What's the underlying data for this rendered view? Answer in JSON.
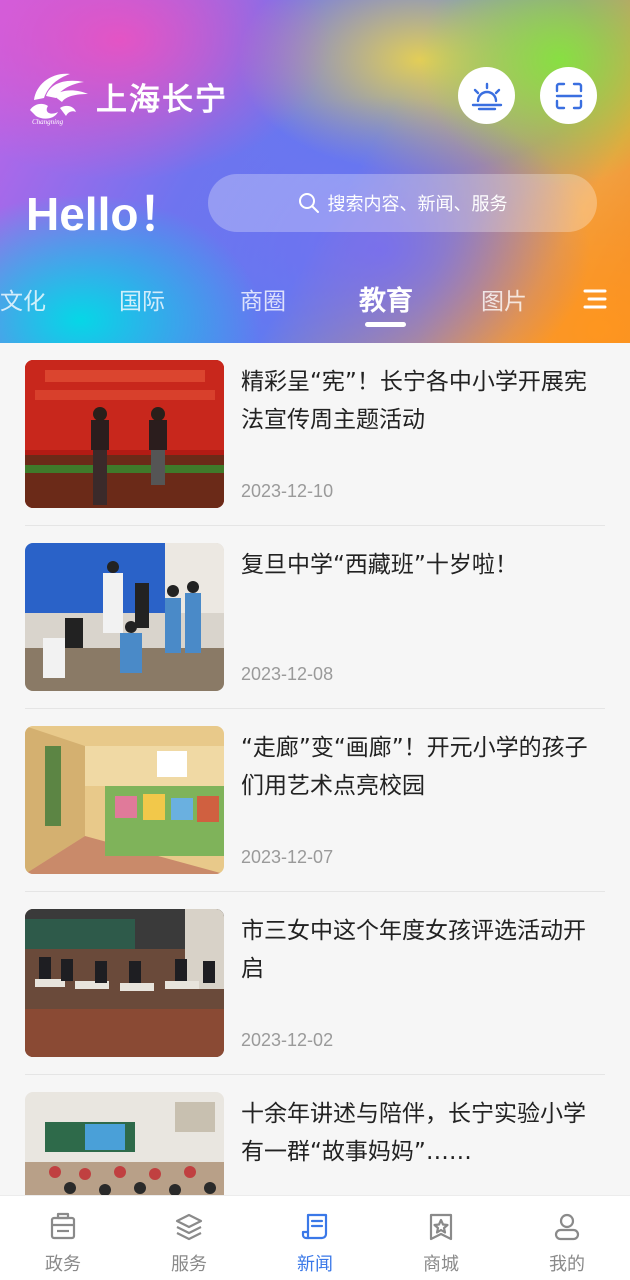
{
  "header": {
    "app_title": "上海长宁",
    "greeting": "Hello！",
    "search_placeholder": "搜索内容、新闻、服务",
    "logo_caption": "Changning"
  },
  "tabs": [
    {
      "label": "文化",
      "active": false
    },
    {
      "label": "国际",
      "active": false
    },
    {
      "label": "商圈",
      "active": false
    },
    {
      "label": "教育",
      "active": true
    },
    {
      "label": "图片",
      "active": false
    }
  ],
  "news": [
    {
      "title": "精彩呈“宪”！长宁各中小学开展宪法宣传周主题活动",
      "date": "2023-12-10"
    },
    {
      "title": "复旦中学“西藏班”十岁啦！",
      "date": "2023-12-08"
    },
    {
      "title": "“走廊”变“画廊”！开元小学的孩子们用艺术点亮校园",
      "date": "2023-12-07"
    },
    {
      "title": "市三女中这个年度女孩评选活动开启",
      "date": "2023-12-02"
    },
    {
      "title": "十余年讲述与陪伴，长宁实验小学有一群“故事妈妈”……",
      "date": ""
    }
  ],
  "bottom_nav": [
    {
      "label": "政务",
      "icon": "government-icon",
      "active": false
    },
    {
      "label": "服务",
      "icon": "layers-icon",
      "active": false
    },
    {
      "label": "新闻",
      "icon": "news-scroll-icon",
      "active": true
    },
    {
      "label": "商城",
      "icon": "shop-star-icon",
      "active": false
    },
    {
      "label": "我的",
      "icon": "user-icon",
      "active": false
    }
  ],
  "colors": {
    "accent": "#3a78e8",
    "nav_inactive": "#8a8a8a",
    "date": "#9a9a9a",
    "list_background": "#f6f6f6"
  }
}
